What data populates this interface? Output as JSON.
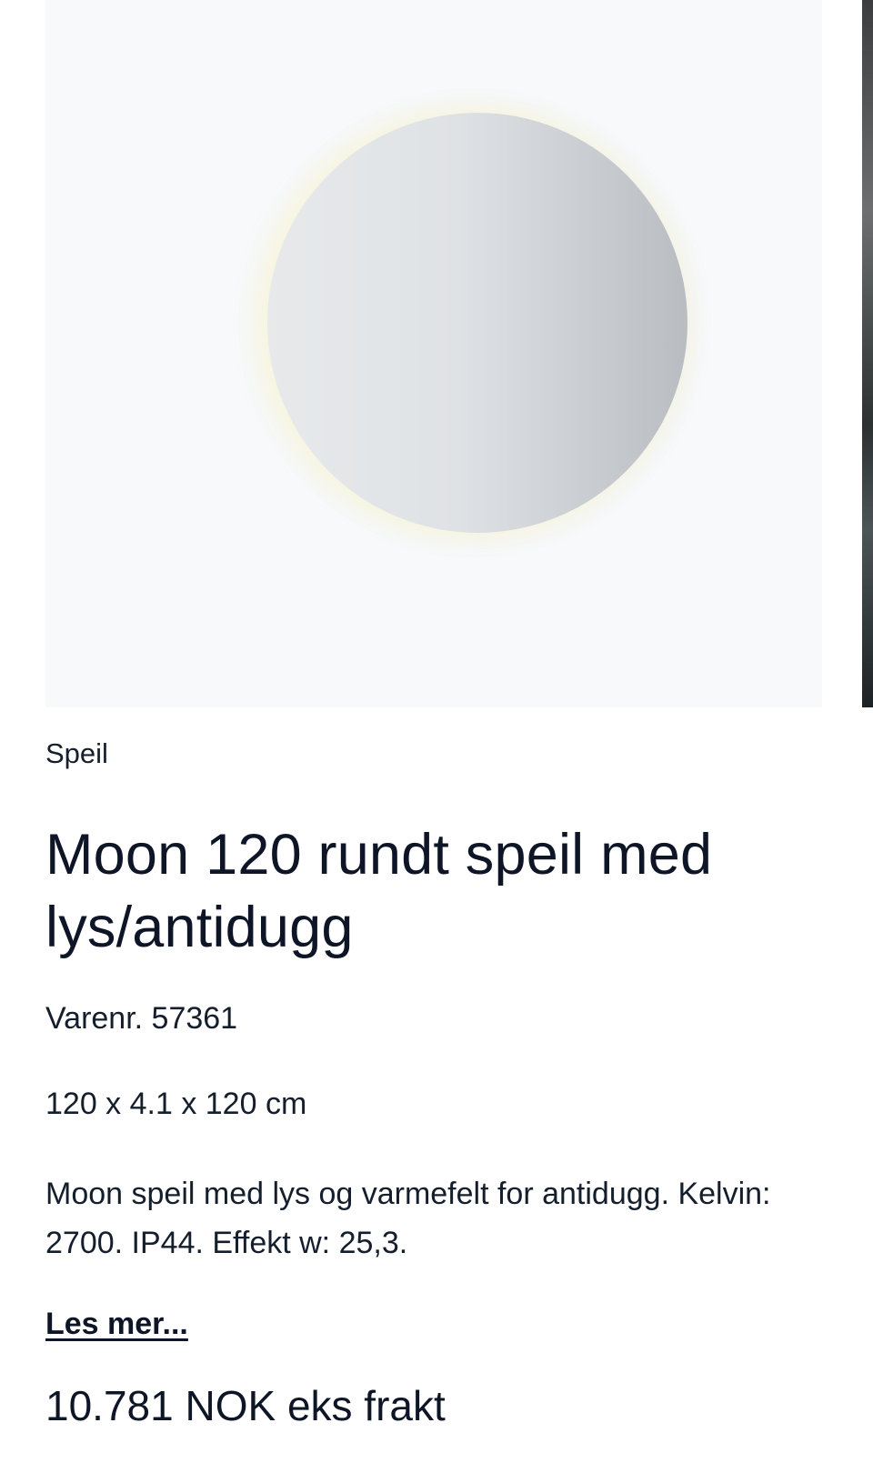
{
  "product": {
    "category": "Speil",
    "title": "Moon 120 rundt speil med lys/antidugg",
    "sku": "Varenr. 57361",
    "dimensions": "120 x 4.1 x 120 cm",
    "description": "Moon speil med lys og varmefelt for antidugg. Kelvin: 2700. IP44. Effekt w: 25,3.",
    "read_more_label": "Les mer...",
    "price": "10.781 NOK eks frakt"
  },
  "gallery": {
    "slide_background": "#f7f9fb"
  }
}
